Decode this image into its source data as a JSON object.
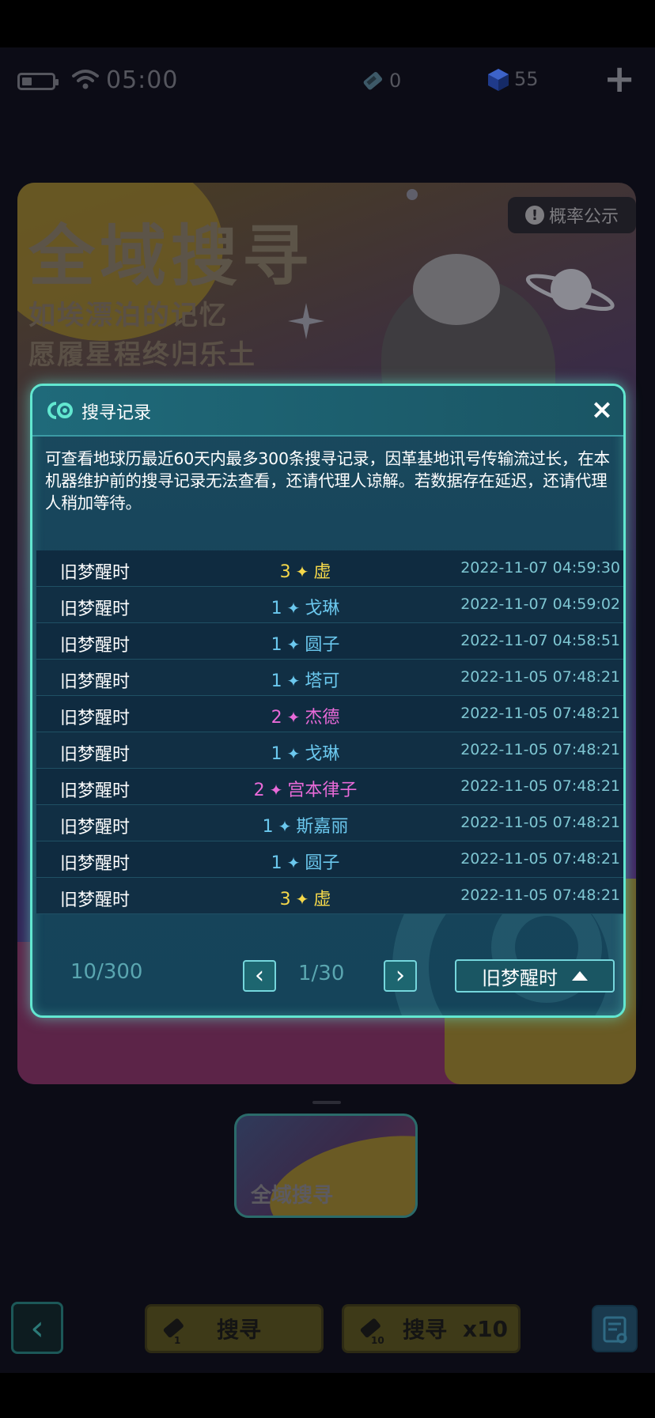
{
  "status": {
    "time": "05:00",
    "resource1": "0",
    "resource2": "55"
  },
  "banner": {
    "title": "全域搜寻",
    "subtitle_line1": "如埃漂泊的记忆",
    "subtitle_line2": "愿履星程终归乐土",
    "probability_button": "概率公示"
  },
  "modal": {
    "title": "搜寻记录",
    "close": "×",
    "notice": "可查看地球历最近60天内最多300条搜寻记录，因革基地讯号传输流过长，在本机器维护前的搜寻记录无法查看，还请代理人谅解。若数据存在延迟，还请代理人稍加等待。",
    "records": [
      {
        "pool": "旧梦醒时",
        "stars": "3",
        "name": "虚",
        "rarity": 3,
        "time": "2022-11-07 04:59:30"
      },
      {
        "pool": "旧梦醒时",
        "stars": "1",
        "name": "戈琳",
        "rarity": 1,
        "time": "2022-11-07 04:59:02"
      },
      {
        "pool": "旧梦醒时",
        "stars": "1",
        "name": "圆子",
        "rarity": 1,
        "time": "2022-11-07 04:58:51"
      },
      {
        "pool": "旧梦醒时",
        "stars": "1",
        "name": "塔可",
        "rarity": 1,
        "time": "2022-11-05 07:48:21"
      },
      {
        "pool": "旧梦醒时",
        "stars": "2",
        "name": "杰德",
        "rarity": 2,
        "time": "2022-11-05 07:48:21"
      },
      {
        "pool": "旧梦醒时",
        "stars": "1",
        "name": "戈琳",
        "rarity": 1,
        "time": "2022-11-05 07:48:21"
      },
      {
        "pool": "旧梦醒时",
        "stars": "2",
        "name": "宫本律子",
        "rarity": 2,
        "time": "2022-11-05 07:48:21"
      },
      {
        "pool": "旧梦醒时",
        "stars": "1",
        "name": "斯嘉丽",
        "rarity": 1,
        "time": "2022-11-05 07:48:21"
      },
      {
        "pool": "旧梦醒时",
        "stars": "1",
        "name": "圆子",
        "rarity": 1,
        "time": "2022-11-05 07:48:21"
      },
      {
        "pool": "旧梦醒时",
        "stars": "3",
        "name": "虚",
        "rarity": 3,
        "time": "2022-11-05 07:48:21"
      }
    ],
    "record_count": "10/300",
    "page_indicator": "1/30",
    "prev": "‹",
    "next": "›",
    "pool_filter": "旧梦醒时"
  },
  "bottom": {
    "card_label": "全域搜寻",
    "back": "‹",
    "search_single": "搜寻",
    "search_single_ticket": "1",
    "search_multi": "搜寻",
    "search_multi_count": "x10",
    "search_multi_ticket": "10"
  },
  "colors": {
    "rarity3": "#f5d84a",
    "rarity2": "#e86ad8",
    "rarity1": "#6bc8ee",
    "modal_border": "#62e7d0"
  }
}
